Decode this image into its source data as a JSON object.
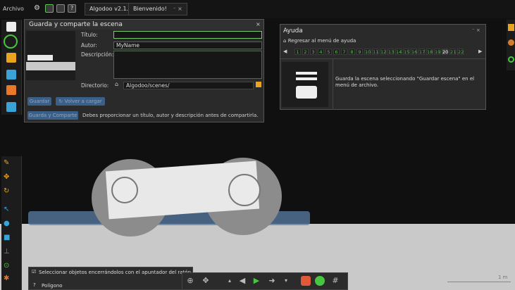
{
  "menubar": {
    "archivo": "Archivo",
    "version_tab": "Algodoo v2.1.0",
    "welcome_tab": "Bienvenido!",
    "tab_controls": "⁻ ×"
  },
  "save_dialog": {
    "title": "Guarda y comparte la escena",
    "close": "×",
    "title_label": "Título:",
    "title_value": "",
    "author_label": "Autor:",
    "author_value": "MyName",
    "description_label": "Descripción:",
    "description_value": "",
    "directory_label": "Directorio:",
    "directory_value": "Algodoo/scenes/",
    "save_button": "Guardar",
    "upload_button": "Volver a cargar",
    "share_button": "Guarda y Comparte",
    "share_hint": "Debes proporcionar un título, autor y descripción antes de compartirla."
  },
  "help_panel": {
    "title": "Ayuda",
    "controls": "⁻ ×",
    "back_link": "Regresar al menú de ayuda",
    "pages": [
      "1",
      "2",
      "3",
      "4",
      "5",
      "6",
      "7",
      "8",
      "9",
      "10",
      "11",
      "12",
      "13",
      "14",
      "15",
      "16",
      "17",
      "18",
      "19",
      "20",
      "21",
      "22"
    ],
    "current_page": "20",
    "description": "Guarda la escena seleccionando \"Guardar escena\" en el menú de archivo."
  },
  "status": {
    "tip": "Seleccionar objetos encerrándolos con el apuntador del ratón",
    "tool_name": "Polígono",
    "scale": "1 m"
  },
  "colors": {
    "accent_green": "#47c640",
    "dialog_bg": "#2a2a2a",
    "ground": "#c9c9c9",
    "button_blue": "#3b5f86"
  }
}
